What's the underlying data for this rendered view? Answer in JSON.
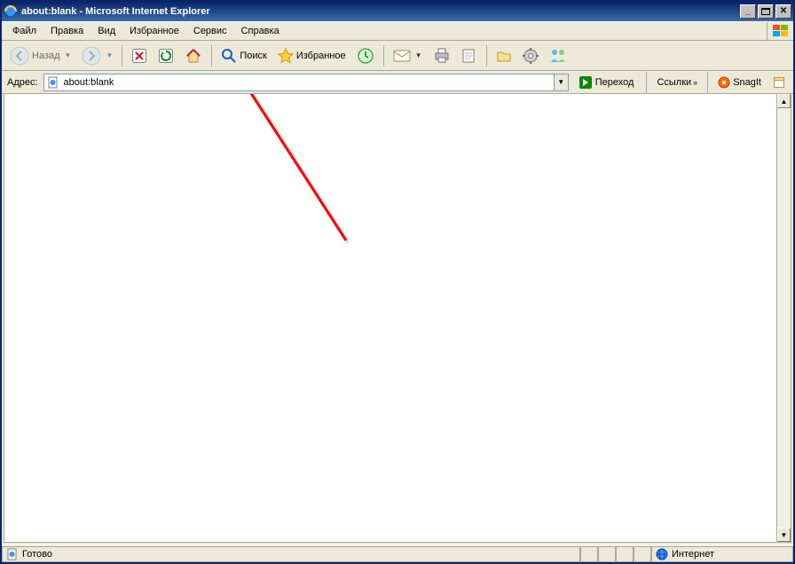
{
  "window": {
    "title": "about:blank - Microsoft Internet Explorer"
  },
  "menu": {
    "items": [
      "Файл",
      "Правка",
      "Вид",
      "Избранное",
      "Сервис",
      "Справка"
    ]
  },
  "toolbar": {
    "back_label": "Назад",
    "search_label": "Поиск",
    "favorites_label": "Избранное"
  },
  "address": {
    "label": "Адрес:",
    "value": "about:blank",
    "go_label": "Переход",
    "links_label": "Ссылки",
    "snagit_label": "SnagIt"
  },
  "status": {
    "ready": "Готово",
    "zone": "Интернет"
  },
  "colors": {
    "titlebar_start": "#0a246a",
    "titlebar_end": "#3a6ea5",
    "chrome_bg": "#ece9d8",
    "arrow": "#ff0000"
  }
}
